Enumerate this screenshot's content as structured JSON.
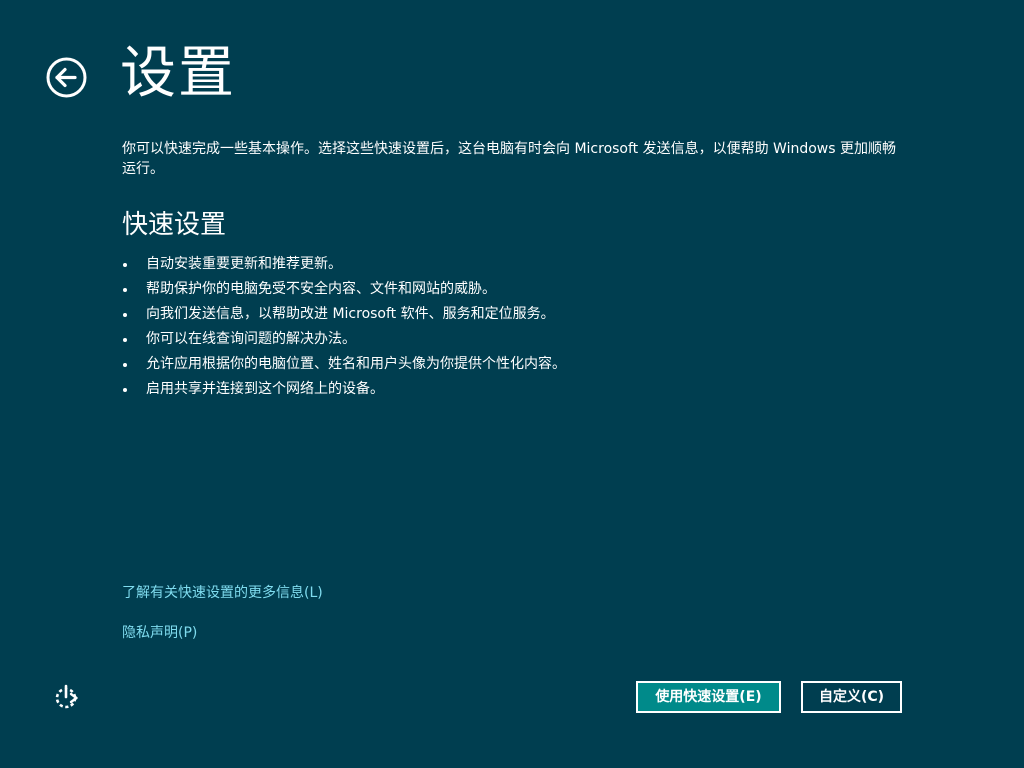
{
  "header": {
    "title": "设置",
    "back_icon": "back-arrow-icon"
  },
  "intro": {
    "text": "你可以快速完成一些基本操作。选择这些快速设置后，这台电脑有时会向 Microsoft 发送信息，以便帮助 Windows 更加顺畅运行。"
  },
  "express": {
    "heading": "快速设置",
    "items": [
      "自动安装重要更新和推荐更新。",
      "帮助保护你的电脑免受不安全内容、文件和网站的威胁。",
      "向我们发送信息，以帮助改进 Microsoft 软件、服务和定位服务。",
      "你可以在线查询问题的解决办法。",
      "允许应用根据你的电脑位置、姓名和用户头像为你提供个性化内容。",
      "启用共享并连接到这个网络上的设备。"
    ]
  },
  "links": {
    "learn_more": "了解有关快速设置的更多信息(L)",
    "privacy": "隐私声明(P)"
  },
  "footer": {
    "ease_of_access_icon": "ease-of-access-icon",
    "express_button": "使用快速设置(E)",
    "customize_button": "自定义(C)"
  },
  "colors": {
    "background": "#003e50",
    "primary_button": "#008a8a",
    "link": "#7fdcef"
  }
}
